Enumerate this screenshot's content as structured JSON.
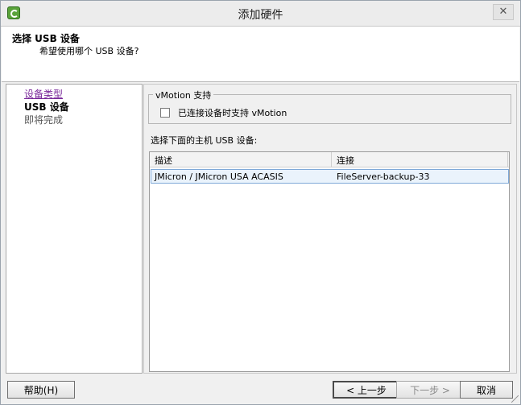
{
  "window": {
    "title": "添加硬件"
  },
  "header": {
    "title": "选择 USB 设备",
    "subtitle": "希望使用哪个 USB 设备?"
  },
  "nav": {
    "items": [
      {
        "label": "设备类型",
        "state": "visited"
      },
      {
        "label": "USB 设备",
        "state": "current"
      },
      {
        "label": "即将完成",
        "state": "pending"
      }
    ]
  },
  "vmotion": {
    "group_label": "vMotion 支持",
    "checkbox_label": "已连接设备时支持 vMotion",
    "checked": false
  },
  "device_list": {
    "prompt": "选择下面的主机 USB 设备:",
    "columns": [
      "描述",
      "连接"
    ],
    "rows": [
      {
        "description": "JMicron / JMicron USA ACASIS",
        "connection": "FileServer-backup-33",
        "selected": true
      }
    ]
  },
  "buttons": {
    "help": "帮助(H)",
    "back": "< 上一步",
    "next": "下一步 >",
    "cancel": "取消"
  }
}
